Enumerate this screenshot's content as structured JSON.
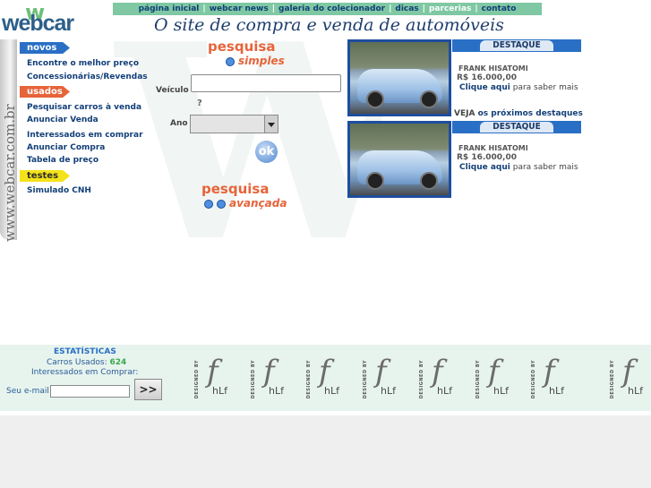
{
  "logo": {
    "text": "webcar"
  },
  "topnav": {
    "items": [
      "página inicial",
      "webcar news",
      "galeria do colecionador",
      "dicas",
      "parcerias",
      "contato"
    ]
  },
  "headline": "O site de compra e venda de automóveis",
  "vertical_brand": "www.webcar.com.br",
  "sidebar": {
    "novos_tag": "novos",
    "novos_links": [
      "Encontre o melhor preço",
      "Concessionárias/Revendas"
    ],
    "usados_tag": "usados",
    "usados_links": [
      "Pesquisar carros à venda",
      "Anunciar Venda",
      "Interessados em comprar",
      "Anunciar Compra",
      "Tabela de preço"
    ],
    "testes_tag": "testes",
    "testes_links": [
      "Simulado CNH"
    ]
  },
  "search_simple": {
    "title": "pesquisa",
    "subtitle": "simples",
    "vehicle_label": "Veículo",
    "vehicle_value": "",
    "help": "?",
    "year_label": "Ano",
    "year_value": "",
    "ok_label": "ok"
  },
  "search_advanced": {
    "title": "pesquisa",
    "subtitle": "avançada"
  },
  "highlights": [
    {
      "banner": "DESTAQUE",
      "seller": "FRANK HISATOMI",
      "price": "R$ 16.000,00",
      "more_link": "Clique aqui",
      "more_text": "para saber mais"
    },
    {
      "banner": "DESTAQUE",
      "seller": "FRANK HISATOMI",
      "price": "R$ 16.000,00",
      "more_link": "Clique aqui",
      "more_text": "para saber mais"
    }
  ],
  "veja": {
    "prefix": "VEJA",
    "link": "os próximos destaques"
  },
  "stats": {
    "title": "ESTATÍSTICAS",
    "used_label": "Carros Usados:",
    "used_value": "624",
    "interested_label": "Interessados em Comprar:",
    "interested_value": "",
    "email_label": "Seu e-mail",
    "email_value": "",
    "submit_label": ">>"
  },
  "designed_by": {
    "by": "DESIGNED BY",
    "brand": "hLf"
  }
}
